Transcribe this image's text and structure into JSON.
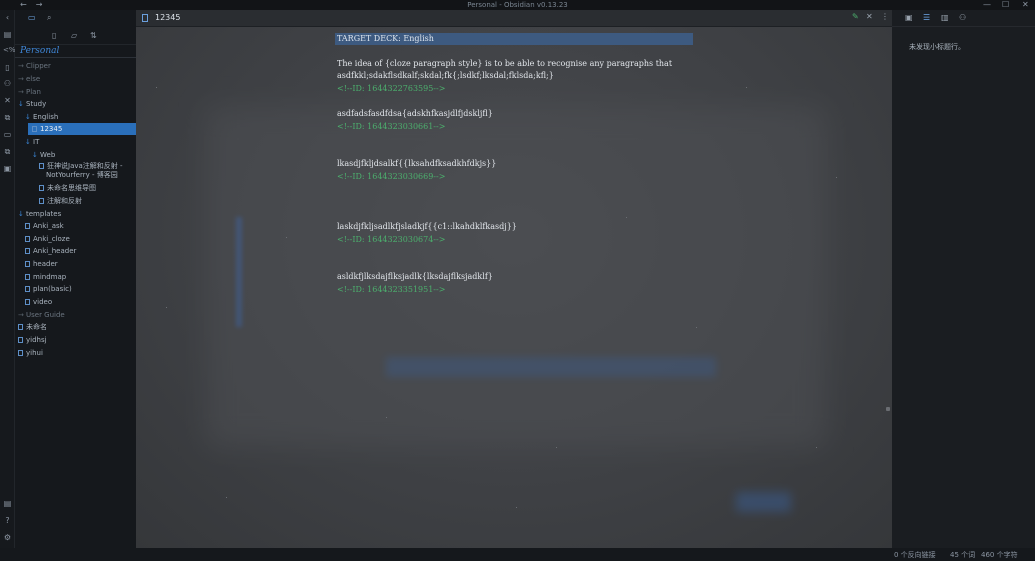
{
  "window": {
    "title": "Personal - Obsidian v0.13.23",
    "back_icon": "←",
    "forward_icon": "→",
    "minimize": "—",
    "maximize": "☐",
    "close": "✕"
  },
  "explorer": {
    "vault_name": "Personal",
    "tree": [
      {
        "label": "Clipper",
        "level": 0,
        "type": "folder",
        "open": false,
        "dim": true
      },
      {
        "label": "else",
        "level": 0,
        "type": "folder",
        "open": false,
        "dim": true
      },
      {
        "label": "Plan",
        "level": 0,
        "type": "folder",
        "open": false,
        "dim": true
      },
      {
        "label": "Study",
        "level": 0,
        "type": "folder",
        "open": true
      },
      {
        "label": "English",
        "level": 1,
        "type": "folder",
        "open": true
      },
      {
        "label": "12345",
        "level": 2,
        "type": "file",
        "active": true
      },
      {
        "label": "IT",
        "level": 1,
        "type": "folder",
        "open": true
      },
      {
        "label": "Web",
        "level": 2,
        "type": "folder",
        "open": true
      },
      {
        "label": "狂神说Java注解和反射 -",
        "label2": "NotYourferry - 博客园",
        "level": 3,
        "type": "file"
      },
      {
        "label": "未命名思维导图",
        "level": 3,
        "type": "file"
      },
      {
        "label": "注解和反射",
        "level": 3,
        "type": "file"
      },
      {
        "label": "templates",
        "level": 0,
        "type": "folder",
        "open": true
      },
      {
        "label": "Anki_ask",
        "level": 1,
        "type": "file"
      },
      {
        "label": "Anki_cloze",
        "level": 1,
        "type": "file"
      },
      {
        "label": "Anki_header",
        "level": 1,
        "type": "file"
      },
      {
        "label": "header",
        "level": 1,
        "type": "file"
      },
      {
        "label": "mindmap",
        "level": 1,
        "type": "file"
      },
      {
        "label": "plan(basic)",
        "level": 1,
        "type": "file"
      },
      {
        "label": "video",
        "level": 1,
        "type": "file"
      },
      {
        "label": "User Guide",
        "level": 0,
        "type": "folder",
        "open": false,
        "dim": true
      },
      {
        "label": "未命名",
        "level": 0,
        "type": "file"
      },
      {
        "label": "yidhsj",
        "level": 0,
        "type": "file"
      },
      {
        "label": "yihui",
        "level": 0,
        "type": "file"
      }
    ]
  },
  "editor": {
    "tab_title": "12345",
    "deck_line": "TARGET DECK: English",
    "paragraph_line1": "The idea of {cloze paragraph style} is to be able to recognise any paragraphs that",
    "paragraph_line2": "asdfkkl;sdakflsdkalf;skdal;fk{;lsdkf;lksdal;fklsda;kfl;}",
    "comment1": "<!--ID: 1644322763595-->",
    "line2": "asdfadsfasdfdsa{adskhfkasjdlfjdskljfl}",
    "comment2": "<!--ID: 1644323030661-->",
    "line3": "lkasdjfkljdsalkf{{lksahdfksadkhfdkjs}}",
    "comment3": "<!--ID: 1644323030669-->",
    "line4": "laskdjfkljsadlkfjsladkjf{{c1::lkahdklfkasdj}}",
    "comment4": "<!--ID: 1644323030674-->",
    "line5": "asldkfjlksdajflksjadlk{lksdajflksjadklf}",
    "comment5": "<!--ID: 1644323351951-->"
  },
  "outline": {
    "empty_message": "未发现小标题行。"
  },
  "status": {
    "backlinks": "0 个反向链接",
    "words": "45 个词",
    "chars": "460 个字符"
  }
}
